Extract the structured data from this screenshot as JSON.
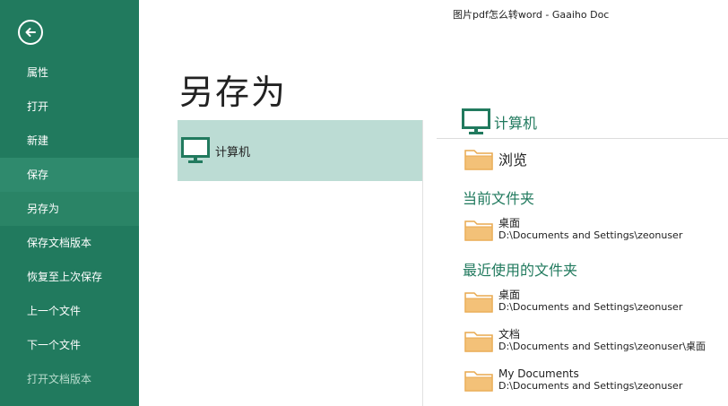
{
  "window_title": "图片pdf怎么转word - Gaaiho Doc",
  "sidebar": {
    "items": [
      {
        "label": "属性"
      },
      {
        "label": "打开"
      },
      {
        "label": "新建"
      },
      {
        "label": "保存"
      },
      {
        "label": "另存为"
      },
      {
        "label": "保存文档版本"
      },
      {
        "label": "恢复至上次保存"
      },
      {
        "label": "上一个文件"
      },
      {
        "label": "下一个文件"
      },
      {
        "label": "打开文档版本"
      }
    ]
  },
  "main": {
    "page_title": "另存为",
    "places": [
      {
        "label": "计算机"
      }
    ]
  },
  "right_panel": {
    "header": "计算机",
    "browse_label": "浏览",
    "current_folder_title": "当前文件夹",
    "current_folder": {
      "name": "桌面",
      "path": "D:\\Documents and Settings\\zeonuser"
    },
    "recent_title": "最近使用的文件夹",
    "recent_folders": [
      {
        "name": "桌面",
        "path": "D:\\Documents and Settings\\zeonuser"
      },
      {
        "name": "文档",
        "path": "D:\\Documents and Settings\\zeonuser\\桌面"
      },
      {
        "name": "My Documents",
        "path": "D:\\Documents and Settings\\zeonuser"
      }
    ]
  },
  "colors": {
    "sidebar_bg": "#217a5e",
    "accent": "#217a5e",
    "selected_place_bg": "#bcdcd4",
    "folder": "#e8a94f"
  },
  "icons": {
    "back": "back-arrow-icon",
    "computer": "computer-monitor-icon",
    "folder": "folder-icon"
  }
}
